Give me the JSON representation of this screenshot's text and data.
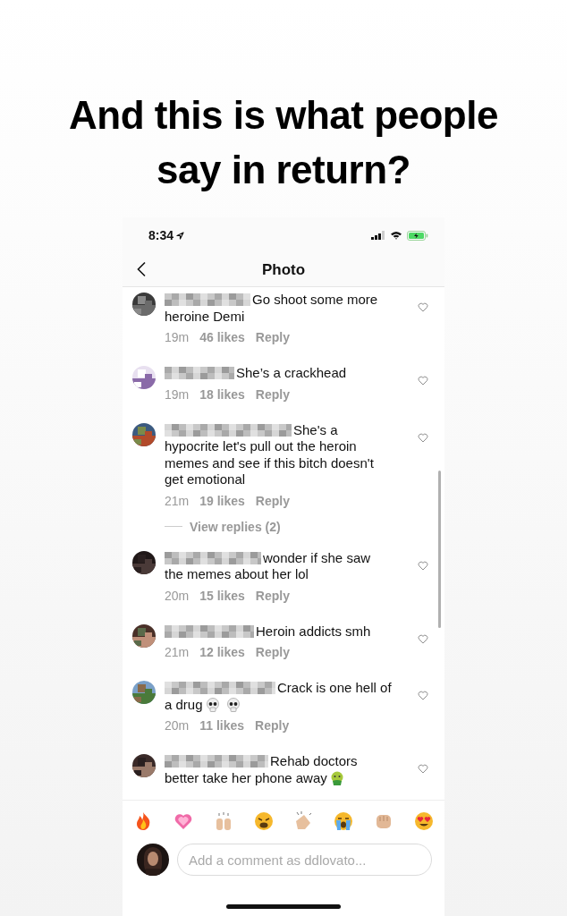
{
  "headline": "And this is what people say in return?",
  "status_bar": {
    "time": "8:34"
  },
  "nav": {
    "title": "Photo"
  },
  "comments": [
    {
      "text": "Go shoot some more heroine Demi",
      "time": "19m",
      "likes": "46 likes",
      "reply": "Reply"
    },
    {
      "text": "She’s a crackhead",
      "time": "19m",
      "likes": "18 likes",
      "reply": "Reply"
    },
    {
      "text": "She's a hypocrite let's pull out the heroin memes and see if this bitch doesn't get emotional",
      "time": "21m",
      "likes": "19 likes",
      "reply": "Reply",
      "replies_link": "View replies (2)"
    },
    {
      "text": "wonder if she saw the memes about her lol",
      "time": "20m",
      "likes": "15 likes",
      "reply": "Reply"
    },
    {
      "text": "Heroin addicts smh",
      "time": "21m",
      "likes": "12 likes",
      "reply": "Reply"
    },
    {
      "text": "Crack is one hell of a drug",
      "time": "20m",
      "likes": "11 likes",
      "reply": "Reply",
      "trailing_emoji": {
        "kind": "skull-pair"
      }
    },
    {
      "text": "Rehab doctors better take her phone away",
      "trailing_emoji": {
        "kind": "nauseated-face"
      }
    }
  ],
  "emoji_bar": [
    {
      "kind": "fire"
    },
    {
      "kind": "heart"
    },
    {
      "kind": "raised-hands"
    },
    {
      "kind": "weary-face"
    },
    {
      "kind": "clap"
    },
    {
      "kind": "crying-face"
    },
    {
      "kind": "fist"
    },
    {
      "kind": "heart-eyes"
    }
  ],
  "composer": {
    "placeholder": "Add a comment as ddlovato..."
  }
}
